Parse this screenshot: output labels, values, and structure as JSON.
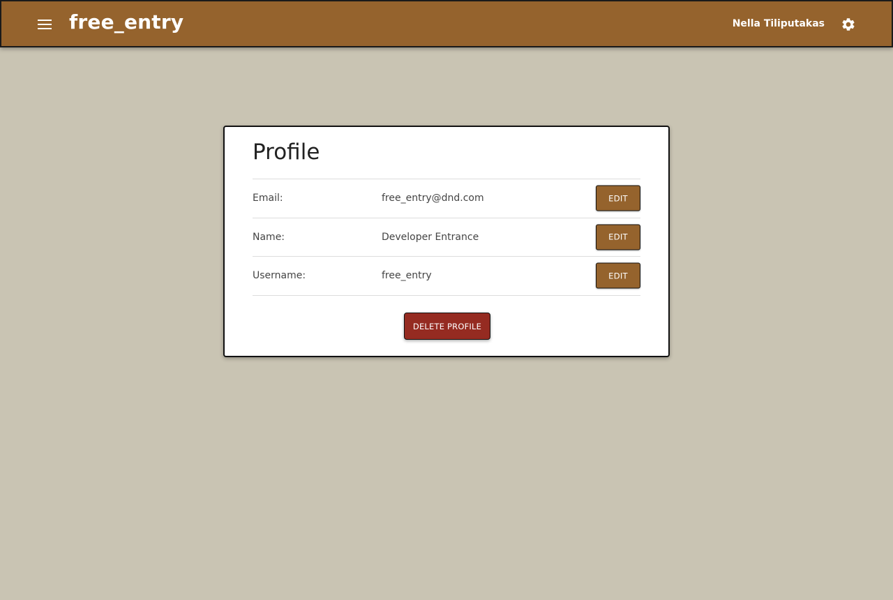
{
  "header": {
    "app_title": "free_entry",
    "user_name": "Nella Tiliputakas",
    "menu_icon": "hamburger-menu-icon",
    "settings_icon": "gear-icon"
  },
  "profile": {
    "title": "Profile",
    "rows": [
      {
        "label": "Email:",
        "value": "free_entry@dnd.com",
        "button": "EDIT"
      },
      {
        "label": "Name:",
        "value": "Developer Entrance",
        "button": "EDIT"
      },
      {
        "label": "Username:",
        "value": "free_entry",
        "button": "EDIT"
      }
    ],
    "delete_button": "DELETE PROFILE"
  },
  "colors": {
    "header_bg": "#95632d",
    "page_bg": "#c9c4b3",
    "edit_button_bg": "#95632d",
    "delete_button_bg": "#952b21"
  }
}
